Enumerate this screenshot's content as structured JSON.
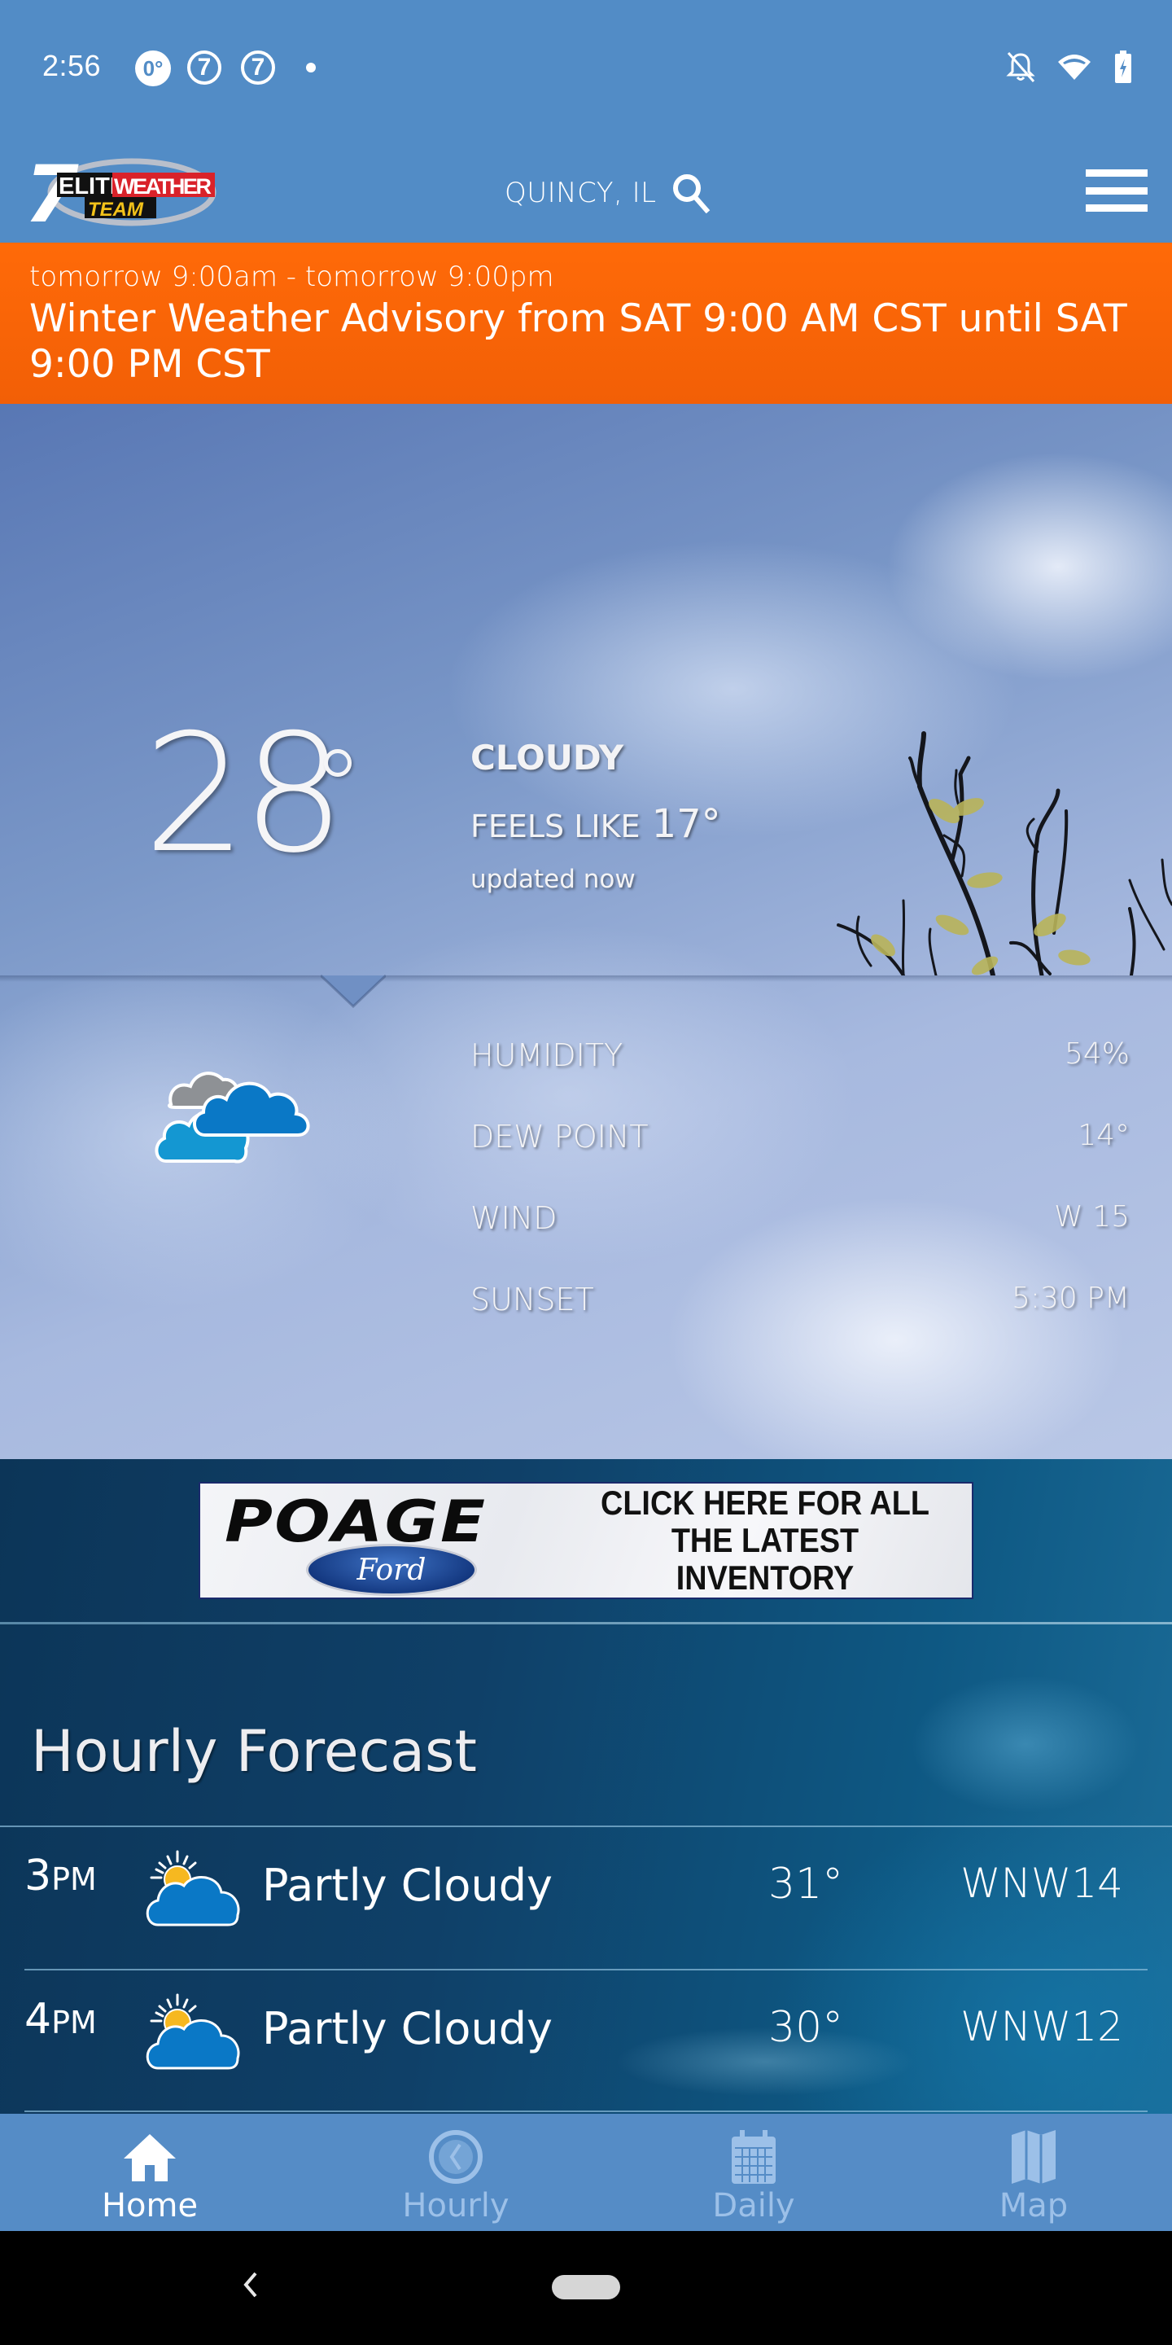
{
  "status_bar": {
    "time": "2:56",
    "notification_icons": [
      "weather-app-icon",
      "channel-7-icon",
      "channel-7-icon",
      "more-dot-icon"
    ],
    "notification_glyphs": [
      "0°",
      "7",
      "7"
    ],
    "system_icons": [
      "bell-off-icon",
      "wifi-icon",
      "battery-charging-icon"
    ]
  },
  "header": {
    "logo": {
      "number": "7",
      "line1a": "ELITE",
      "line1b": "WEATHER",
      "line2": "TEAM"
    },
    "location": "QUINCY, IL",
    "search_icon": "search-icon",
    "menu_icon": "hamburger-menu-icon"
  },
  "alert": {
    "time_range": "tomorrow 9:00am - tomorrow 9:00pm",
    "title": "Winter Weather Advisory from SAT 9:00 AM CST until SAT 9:00 PM CST",
    "color": "#ff6a08"
  },
  "current": {
    "temperature": "28",
    "condition": "CLOUDY",
    "feels_like_label": "FEELS LIKE",
    "feels_like_value": "17°",
    "updated": "updated now",
    "icon": "cloudy-icon",
    "details": [
      {
        "label": "HUMIDITY",
        "value": "54%"
      },
      {
        "label": "DEW POINT",
        "value": "14°"
      },
      {
        "label": "WIND",
        "value": "W 15"
      },
      {
        "label": "SUNSET",
        "value": "5:30 PM"
      }
    ]
  },
  "ad": {
    "brand": "POAGE",
    "sub_brand": "Ford",
    "cta_line1": "CLICK HERE FOR ALL",
    "cta_line2": "THE LATEST INVENTORY"
  },
  "hourly": {
    "title": "Hourly Forecast",
    "rows": [
      {
        "hour": "3",
        "ampm": "PM",
        "icon": "partly-cloudy-icon",
        "condition": "Partly Cloudy",
        "temp": "31°",
        "wind": "WNW14"
      },
      {
        "hour": "4",
        "ampm": "PM",
        "icon": "partly-cloudy-icon",
        "condition": "Partly Cloudy",
        "temp": "30°",
        "wind": "WNW12"
      }
    ]
  },
  "bottom_nav": {
    "items": [
      {
        "label": "Home",
        "icon": "home-icon",
        "active": true
      },
      {
        "label": "Hourly",
        "icon": "clock-icon",
        "active": false
      },
      {
        "label": "Daily",
        "icon": "calendar-icon",
        "active": false
      },
      {
        "label": "Map",
        "icon": "map-icon",
        "active": false
      }
    ]
  },
  "colors": {
    "header_blue": "#528cc6",
    "alert_orange": "#ff6a08",
    "nav_inactive": "#9cc0e8",
    "cloud_blue": "#0a78c6",
    "sun_yellow": "#f6b820"
  }
}
